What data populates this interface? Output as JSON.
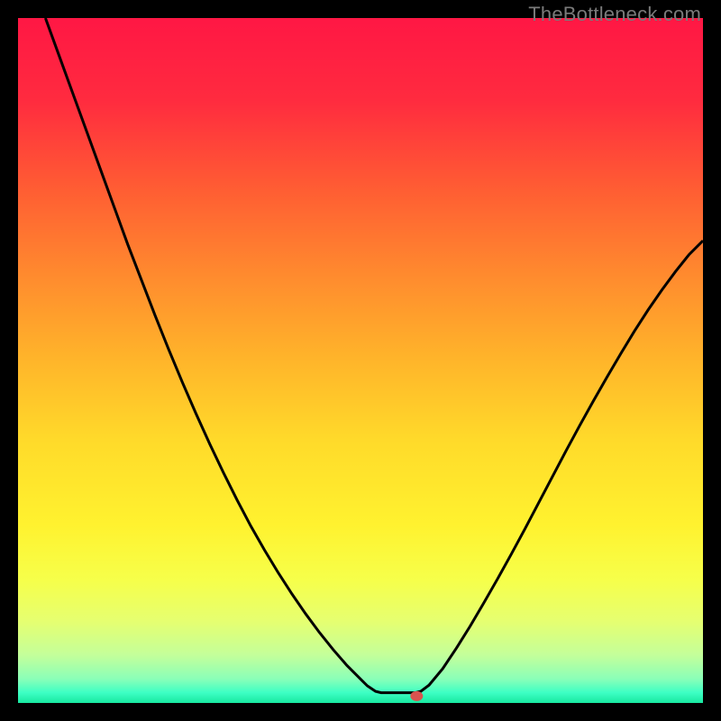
{
  "watermark": "TheBottleneck.com",
  "chart_data": {
    "type": "line",
    "title": "",
    "xlabel": "",
    "ylabel": "",
    "xlim": [
      0,
      100
    ],
    "ylim": [
      0,
      100
    ],
    "curve": [
      {
        "x": 4.0,
        "y": 100.0
      },
      {
        "x": 6.0,
        "y": 94.5
      },
      {
        "x": 8.0,
        "y": 89.0
      },
      {
        "x": 10.0,
        "y": 83.5
      },
      {
        "x": 12.0,
        "y": 78.0
      },
      {
        "x": 14.0,
        "y": 72.5
      },
      {
        "x": 16.0,
        "y": 67.0
      },
      {
        "x": 18.0,
        "y": 61.8
      },
      {
        "x": 20.0,
        "y": 56.6
      },
      {
        "x": 22.0,
        "y": 51.6
      },
      {
        "x": 24.0,
        "y": 46.8
      },
      {
        "x": 26.0,
        "y": 42.2
      },
      {
        "x": 28.0,
        "y": 37.8
      },
      {
        "x": 30.0,
        "y": 33.6
      },
      {
        "x": 32.0,
        "y": 29.6
      },
      {
        "x": 34.0,
        "y": 25.8
      },
      {
        "x": 36.0,
        "y": 22.3
      },
      {
        "x": 38.0,
        "y": 19.0
      },
      {
        "x": 40.0,
        "y": 15.9
      },
      {
        "x": 42.0,
        "y": 13.0
      },
      {
        "x": 44.0,
        "y": 10.3
      },
      {
        "x": 46.0,
        "y": 7.8
      },
      {
        "x": 48.0,
        "y": 5.5
      },
      {
        "x": 50.0,
        "y": 3.5
      },
      {
        "x": 51.0,
        "y": 2.5
      },
      {
        "x": 52.2,
        "y": 1.7
      },
      {
        "x": 53.0,
        "y": 1.5
      },
      {
        "x": 54.0,
        "y": 1.5
      },
      {
        "x": 55.0,
        "y": 1.5
      },
      {
        "x": 56.0,
        "y": 1.5
      },
      {
        "x": 57.0,
        "y": 1.5
      },
      {
        "x": 58.0,
        "y": 1.5
      },
      {
        "x": 58.8,
        "y": 1.7
      },
      {
        "x": 60.0,
        "y": 2.6
      },
      {
        "x": 62.0,
        "y": 5.0
      },
      {
        "x": 64.0,
        "y": 8.0
      },
      {
        "x": 66.0,
        "y": 11.2
      },
      {
        "x": 68.0,
        "y": 14.6
      },
      {
        "x": 70.0,
        "y": 18.1
      },
      {
        "x": 72.0,
        "y": 21.7
      },
      {
        "x": 74.0,
        "y": 25.4
      },
      {
        "x": 76.0,
        "y": 29.2
      },
      {
        "x": 78.0,
        "y": 33.0
      },
      {
        "x": 80.0,
        "y": 36.8
      },
      {
        "x": 82.0,
        "y": 40.5
      },
      {
        "x": 84.0,
        "y": 44.1
      },
      {
        "x": 86.0,
        "y": 47.6
      },
      {
        "x": 88.0,
        "y": 51.0
      },
      {
        "x": 90.0,
        "y": 54.3
      },
      {
        "x": 92.0,
        "y": 57.4
      },
      {
        "x": 94.0,
        "y": 60.3
      },
      {
        "x": 96.0,
        "y": 63.0
      },
      {
        "x": 98.0,
        "y": 65.5
      },
      {
        "x": 100.0,
        "y": 67.5
      }
    ],
    "marker": {
      "x": 58.2,
      "y": 1.0,
      "color": "#d9534f"
    },
    "gradient_stops": [
      {
        "offset": 0.0,
        "color": "#ff1744"
      },
      {
        "offset": 0.12,
        "color": "#ff2b3f"
      },
      {
        "offset": 0.25,
        "color": "#ff5d33"
      },
      {
        "offset": 0.38,
        "color": "#ff8c2e"
      },
      {
        "offset": 0.5,
        "color": "#ffb52a"
      },
      {
        "offset": 0.62,
        "color": "#ffdb2a"
      },
      {
        "offset": 0.74,
        "color": "#fff22f"
      },
      {
        "offset": 0.82,
        "color": "#f6ff4a"
      },
      {
        "offset": 0.88,
        "color": "#e6ff70"
      },
      {
        "offset": 0.93,
        "color": "#c4ff9a"
      },
      {
        "offset": 0.965,
        "color": "#8affb8"
      },
      {
        "offset": 0.985,
        "color": "#3dffc4"
      },
      {
        "offset": 1.0,
        "color": "#18e8a0"
      }
    ]
  }
}
